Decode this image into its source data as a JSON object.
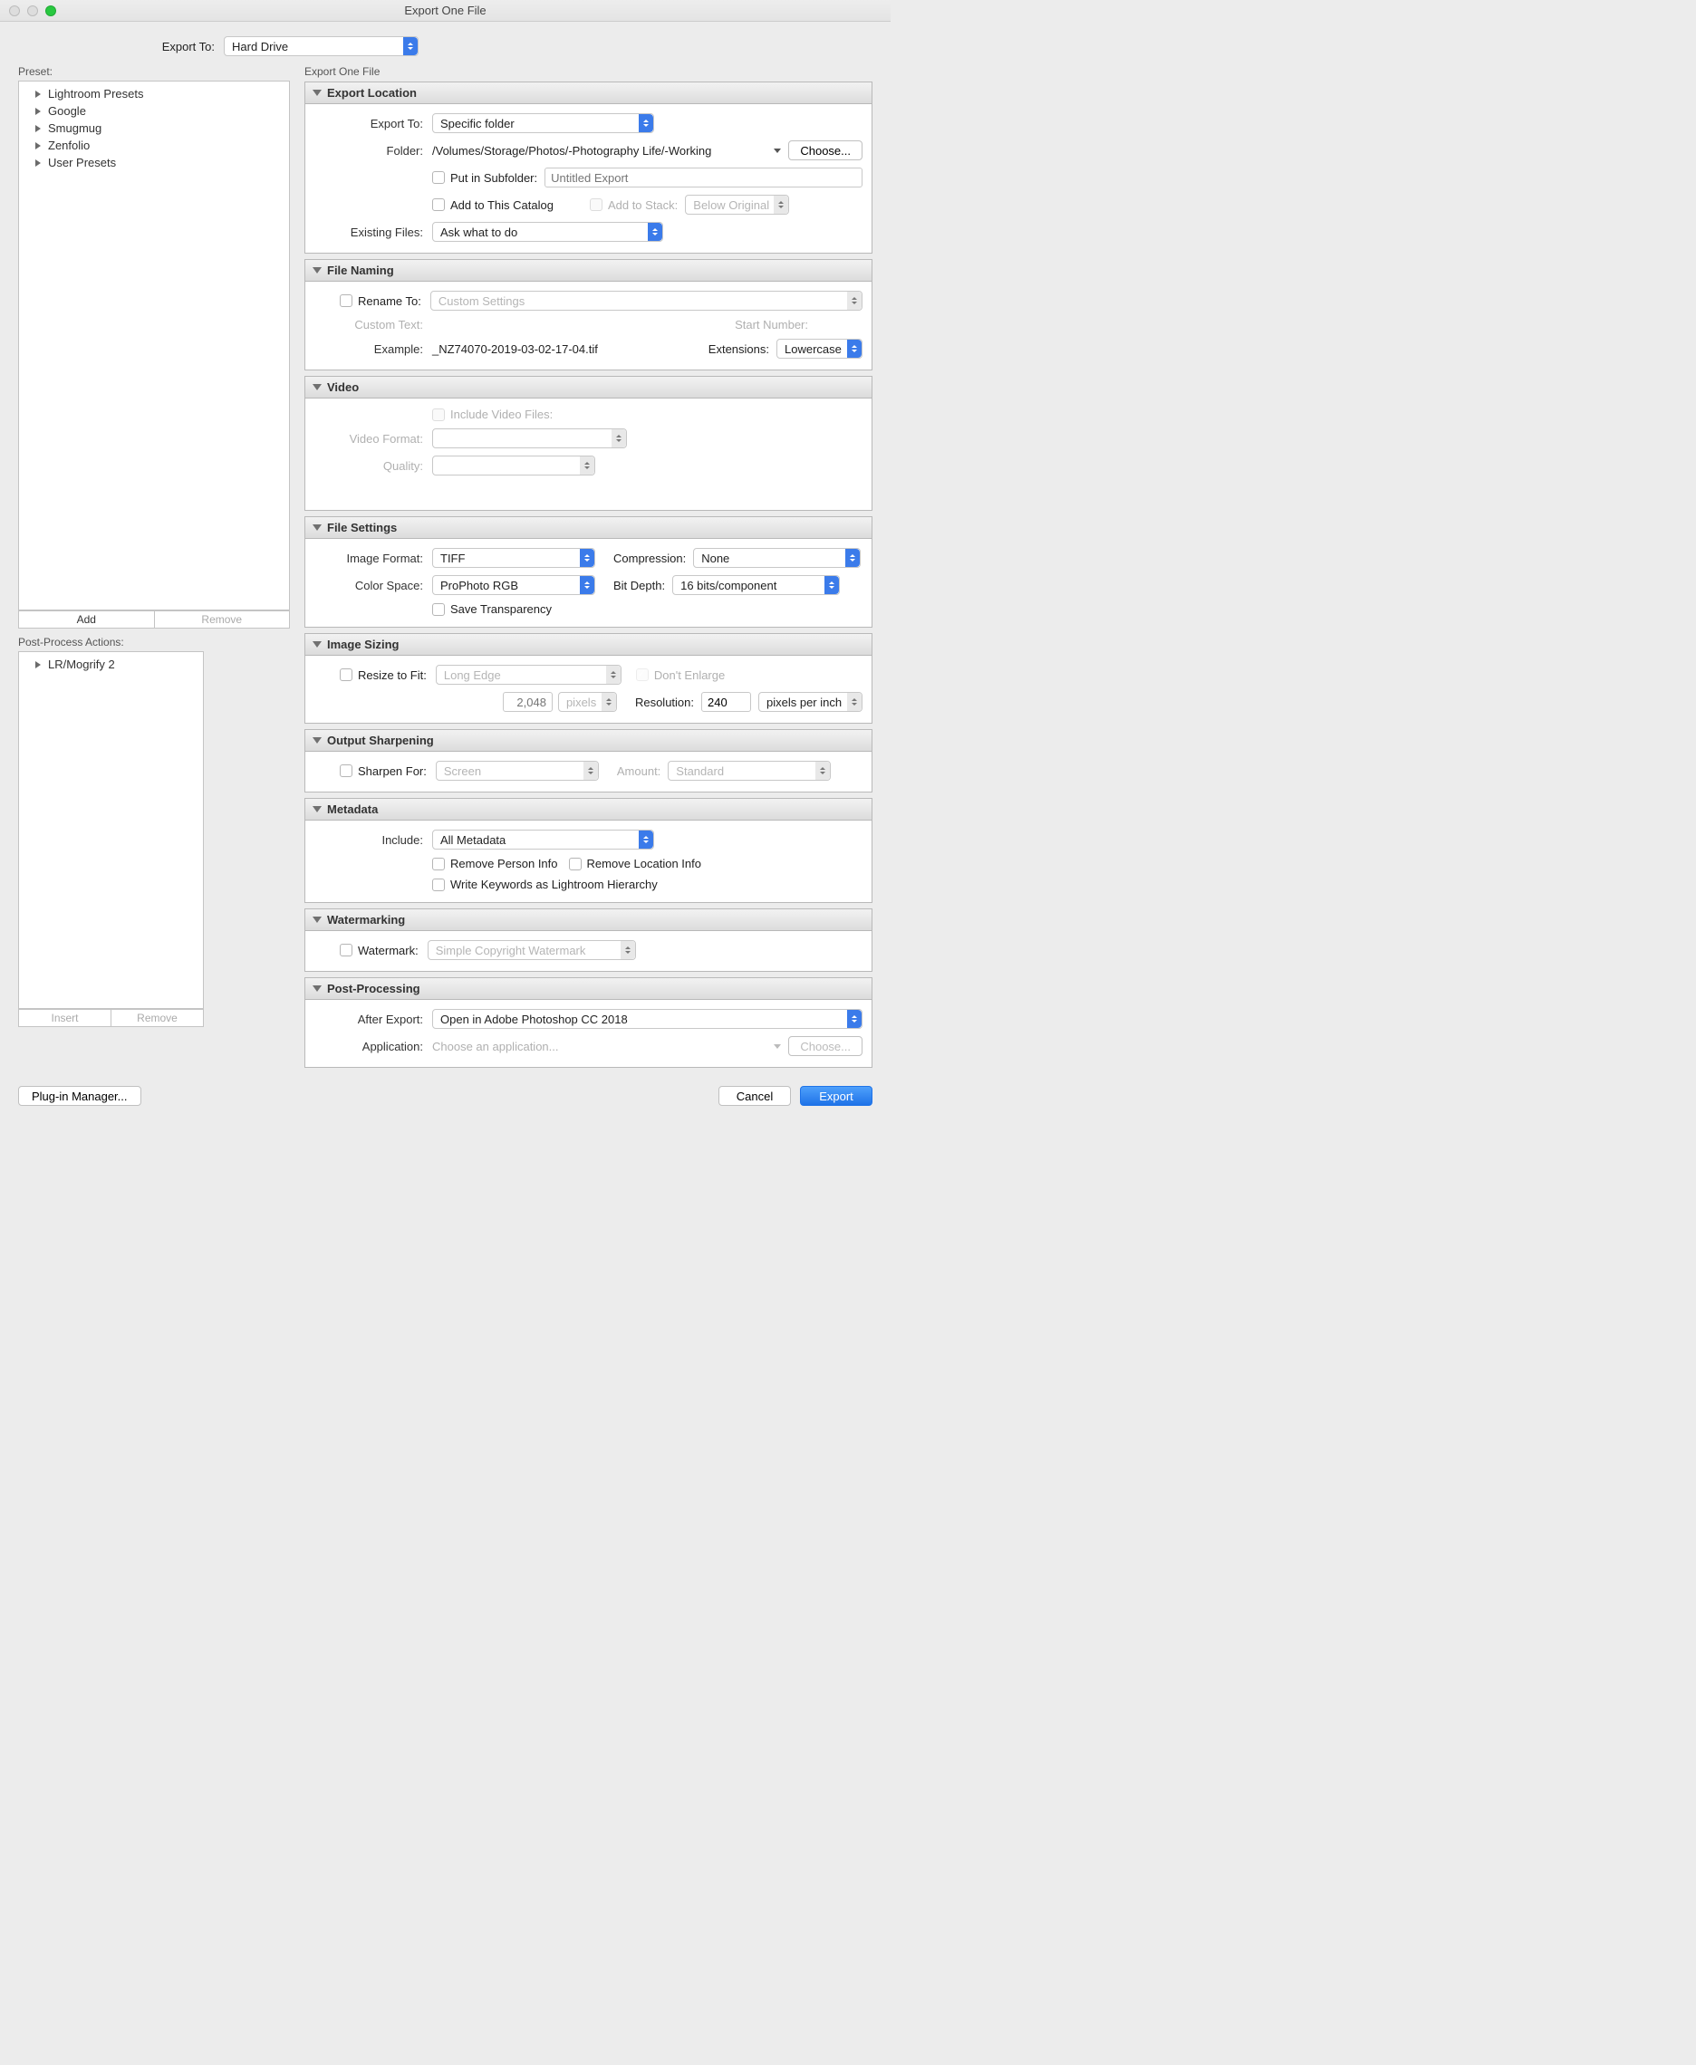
{
  "window": {
    "title": "Export One File"
  },
  "export_to": {
    "label": "Export To:",
    "value": "Hard Drive"
  },
  "preset": {
    "label": "Preset:",
    "items": [
      "Lightroom Presets",
      "Google",
      "Smugmug",
      "Zenfolio",
      "User Presets"
    ],
    "add": "Add",
    "remove": "Remove"
  },
  "postproc_actions": {
    "label": "Post-Process Actions:",
    "items": [
      "LR/Mogrify 2"
    ],
    "insert": "Insert",
    "remove": "Remove"
  },
  "right_title": "Export One File",
  "sections": {
    "location": {
      "title": "Export Location",
      "export_to_label": "Export To:",
      "export_to_value": "Specific folder",
      "folder_label": "Folder:",
      "folder_path": "/Volumes/Storage/Photos/-Photography Life/-Working",
      "choose": "Choose...",
      "subfolder_label": "Put in Subfolder:",
      "subfolder_placeholder": "Untitled Export",
      "add_catalog": "Add to This Catalog",
      "add_stack": "Add to Stack:",
      "stack_value": "Below Original",
      "existing_label": "Existing Files:",
      "existing_value": "Ask what to do"
    },
    "naming": {
      "title": "File Naming",
      "rename_label": "Rename To:",
      "rename_value": "Custom Settings",
      "custom_text_label": "Custom Text:",
      "start_num_label": "Start Number:",
      "example_label": "Example:",
      "example_value": "_NZ74070-2019-03-02-17-04.tif",
      "ext_label": "Extensions:",
      "ext_value": "Lowercase"
    },
    "video": {
      "title": "Video",
      "include": "Include Video Files:",
      "format_label": "Video Format:",
      "quality_label": "Quality:"
    },
    "filesettings": {
      "title": "File Settings",
      "format_label": "Image Format:",
      "format_value": "TIFF",
      "compression_label": "Compression:",
      "compression_value": "None",
      "colorspace_label": "Color Space:",
      "colorspace_value": "ProPhoto RGB",
      "bitdepth_label": "Bit Depth:",
      "bitdepth_value": "16 bits/component",
      "save_trans": "Save Transparency"
    },
    "sizing": {
      "title": "Image Sizing",
      "resize_label": "Resize to Fit:",
      "resize_value": "Long Edge",
      "dont_enlarge": "Don't Enlarge",
      "dim_value": "2,048",
      "dim_unit": "pixels",
      "res_label": "Resolution:",
      "res_value": "240",
      "res_unit": "pixels per inch"
    },
    "sharpen": {
      "title": "Output Sharpening",
      "sharpen_label": "Sharpen For:",
      "sharpen_value": "Screen",
      "amount_label": "Amount:",
      "amount_value": "Standard"
    },
    "metadata": {
      "title": "Metadata",
      "include_label": "Include:",
      "include_value": "All Metadata",
      "remove_person": "Remove Person Info",
      "remove_location": "Remove Location Info",
      "write_keywords": "Write Keywords as Lightroom Hierarchy"
    },
    "watermark": {
      "title": "Watermarking",
      "watermark_label": "Watermark:",
      "watermark_value": "Simple Copyright Watermark"
    },
    "postprocessing": {
      "title": "Post-Processing",
      "after_label": "After Export:",
      "after_value": "Open in Adobe Photoshop CC 2018",
      "app_label": "Application:",
      "app_placeholder": "Choose an application...",
      "choose": "Choose..."
    }
  },
  "footer": {
    "plugin_mgr": "Plug-in Manager...",
    "cancel": "Cancel",
    "export": "Export"
  }
}
